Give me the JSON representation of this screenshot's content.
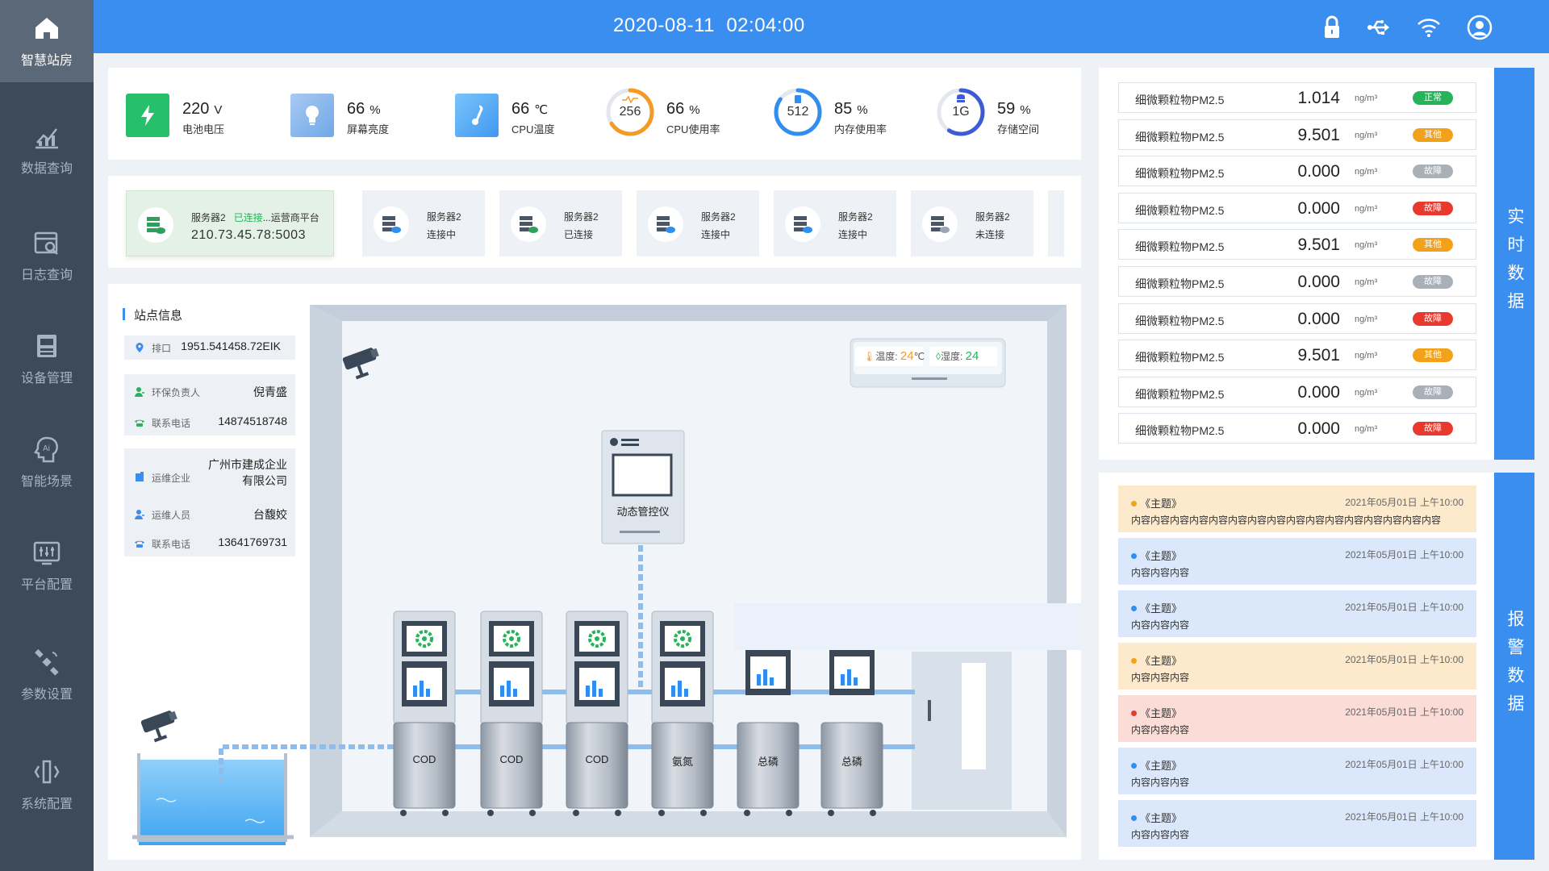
{
  "sidebar": {
    "items": [
      {
        "label": "智慧站房",
        "icon": "home-icon"
      },
      {
        "label": "数据查询",
        "icon": "chart-icon"
      },
      {
        "label": "日志查询",
        "icon": "log-icon"
      },
      {
        "label": "设备管理",
        "icon": "device-icon"
      },
      {
        "label": "智能场景",
        "icon": "ai-icon"
      },
      {
        "label": "平台配置",
        "icon": "platform-icon"
      },
      {
        "label": "参数设置",
        "icon": "satellite-icon"
      },
      {
        "label": "系统配置",
        "icon": "system-icon"
      }
    ]
  },
  "header": {
    "date": "2020-08-11",
    "time": "02:04:00"
  },
  "stats": [
    {
      "value": "220",
      "unit": "V",
      "label": "电池电压",
      "color": "#27c06a"
    },
    {
      "value": "66",
      "unit": "%",
      "label": "屏幕亮度",
      "color": "#6fa8e8"
    },
    {
      "value": "66",
      "unit": "℃",
      "label": "CPU温度",
      "color": "#4ea7f5"
    },
    {
      "value": "66",
      "unit": "%",
      "label": "CPU使用率",
      "ring": "256",
      "percent": 66,
      "color": "#f59a23"
    },
    {
      "value": "85",
      "unit": "%",
      "label": "内存使用率",
      "ring": "512",
      "percent": 85,
      "color": "#2f8ef0"
    },
    {
      "value": "59",
      "unit": "%",
      "label": "存储空间",
      "ring": "1G",
      "percent": 59,
      "color": "#3d5bd6"
    }
  ],
  "servers": [
    {
      "name": "服务器2",
      "state": "已连接",
      "extra": "...运营商平台",
      "address": "210.73.45.78:5003"
    },
    {
      "name": "服务器2",
      "state": "连接中"
    },
    {
      "name": "服务器2",
      "state": "已连接"
    },
    {
      "name": "服务器2",
      "state": "连接中"
    },
    {
      "name": "服务器2",
      "state": "连接中"
    },
    {
      "name": "服务器2",
      "state": "未连接"
    }
  ],
  "site": {
    "title": "站点信息",
    "outlet_key": "排口",
    "outlet_value": "1951.541458.72EIK",
    "env_key": "环保负责人",
    "env_value": "倪青盛",
    "phone_key": "联系电话",
    "phone_value": "14874518748",
    "ops_company_key": "运维企业",
    "ops_company_value_1": "广州市建成企业",
    "ops_company_value_2": "有限公司",
    "ops_person_key": "运维人员",
    "ops_person_value": "台馥姣",
    "ops_phone_key": "联系电话",
    "ops_phone_value": "13641769731"
  },
  "scene": {
    "ac_temp_label": "温度:",
    "ac_temp_value": "24",
    "ac_temp_unit": "℃",
    "ac_hum_label": "湿度:",
    "ac_hum_value": "24",
    "controller_label": "动态管控仪",
    "devices": [
      "COD",
      "COD",
      "COD",
      "氨氮",
      "总磷",
      "总磷"
    ]
  },
  "realtime": {
    "tab": "实时数据",
    "unit": "ng/m³",
    "rows": [
      {
        "name": "细微颗粒物PM2.5",
        "value": "1.014",
        "status": "正常",
        "color": "#27b35a"
      },
      {
        "name": "细微颗粒物PM2.5",
        "value": "9.501",
        "status": "其他",
        "color": "#f2a11b"
      },
      {
        "name": "细微颗粒物PM2.5",
        "value": "0.000",
        "status": "故障",
        "color": "#a9b0b8"
      },
      {
        "name": "细微颗粒物PM2.5",
        "value": "0.000",
        "status": "故障",
        "color": "#e8392f"
      },
      {
        "name": "细微颗粒物PM2.5",
        "value": "9.501",
        "status": "其他",
        "color": "#f2a11b"
      },
      {
        "name": "细微颗粒物PM2.5",
        "value": "0.000",
        "status": "故障",
        "color": "#a9b0b8"
      },
      {
        "name": "细微颗粒物PM2.5",
        "value": "0.000",
        "status": "故障",
        "color": "#e8392f"
      },
      {
        "name": "细微颗粒物PM2.5",
        "value": "9.501",
        "status": "其他",
        "color": "#f2a11b"
      },
      {
        "name": "细微颗粒物PM2.5",
        "value": "0.000",
        "status": "故障",
        "color": "#a9b0b8"
      },
      {
        "name": "细微颗粒物PM2.5",
        "value": "0.000",
        "status": "故障",
        "color": "#e8392f"
      }
    ]
  },
  "alarms": {
    "tab": "报警数据",
    "rows": [
      {
        "title": "《主题》",
        "time": "2021年05月01日 上午10:00",
        "body": "内容内容内容内容内容内容内容内容内容内容内容内容内容内容内容内容",
        "bg": "#fde9cc",
        "dot": "#f2a11b"
      },
      {
        "title": "《主题》",
        "time": "2021年05月01日 上午10:00",
        "body": "内容内容内容",
        "bg": "#dbe8fb",
        "dot": "#2f8ef0"
      },
      {
        "title": "《主题》",
        "time": "2021年05月01日 上午10:00",
        "body": "内容内容内容",
        "bg": "#dbe8fb",
        "dot": "#2f8ef0"
      },
      {
        "title": "《主题》",
        "time": "2021年05月01日 上午10:00",
        "body": "内容内容内容",
        "bg": "#fde9cc",
        "dot": "#f2a11b"
      },
      {
        "title": "《主题》",
        "time": "2021年05月01日 上午10:00",
        "body": "内容内容内容",
        "bg": "#fcdcd7",
        "dot": "#e8392f"
      },
      {
        "title": "《主题》",
        "time": "2021年05月01日 上午10:00",
        "body": "内容内容内容",
        "bg": "#dbe8fb",
        "dot": "#2f8ef0"
      },
      {
        "title": "《主题》",
        "time": "2021年05月01日 上午10:00",
        "body": "内容内容内容",
        "bg": "#dbe8fb",
        "dot": "#2f8ef0"
      }
    ]
  }
}
